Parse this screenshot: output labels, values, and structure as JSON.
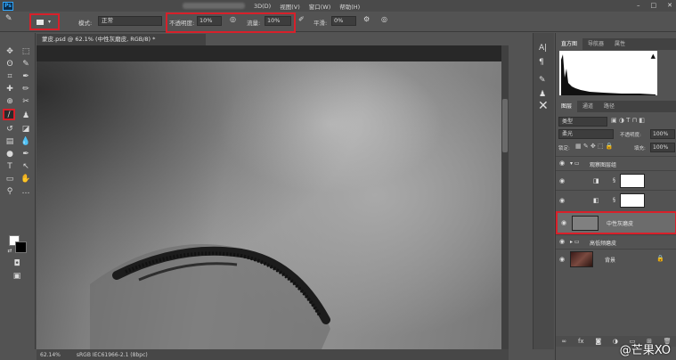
{
  "menubar": {
    "items": [
      "3D(D)",
      "视图(V)",
      "窗口(W)",
      "帮助(H)"
    ]
  },
  "options": {
    "mode_label": "模式:",
    "mode_value": "正常",
    "opacity_label": "不透明度:",
    "opacity_value": "10%",
    "flow_label": "流量:",
    "flow_value": "10%",
    "smooth_label": "平滑:",
    "smooth_value": "0%"
  },
  "document": {
    "tab_title": "蒙皮.psd @ 62.1% (中性灰磨皮, RGB/8) *",
    "zoom": "62.14%",
    "profile": "sRGB IEC61966-2.1 (8bpc)"
  },
  "panels": {
    "top_tabs": [
      "直方图",
      "导航器",
      "属性"
    ],
    "layer_tabs": [
      "图层",
      "通道",
      "路径"
    ],
    "filter_kind": "类型",
    "blend_mode": "柔光",
    "opacity_label": "不透明度:",
    "opacity_value": "100%",
    "lock_label": "锁定:",
    "fill_label": "填充:",
    "fill_value": "100%"
  },
  "layers": [
    {
      "name": "观察图层组",
      "type": "group"
    },
    {
      "name": "",
      "type": "adjustment"
    },
    {
      "name": "",
      "type": "adjustment"
    },
    {
      "name": "中性灰磨皮",
      "type": "layer",
      "selected": true
    },
    {
      "name": "高低频磨皮",
      "type": "group"
    },
    {
      "name": "背景",
      "type": "background"
    }
  ],
  "watermark": "@芒果XO",
  "colors": {
    "highlight": "#d8202a",
    "foreground": "#ffffff",
    "background": "#000000"
  }
}
